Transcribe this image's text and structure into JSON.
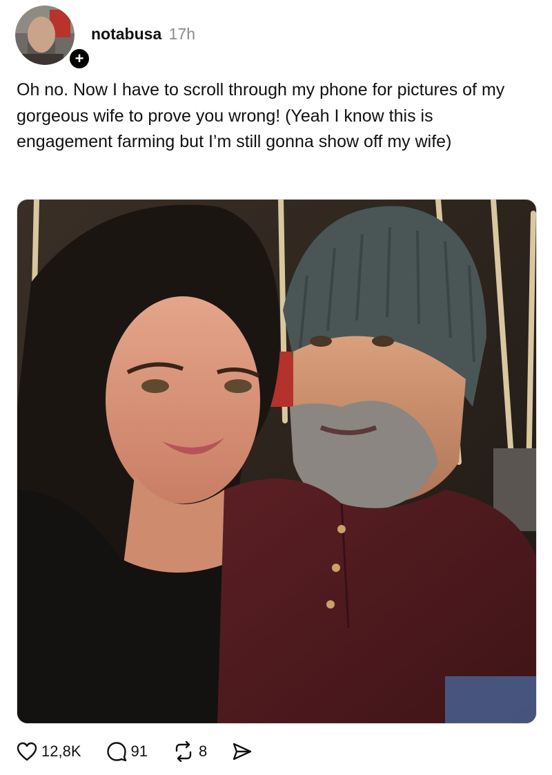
{
  "post": {
    "username": "notabusa",
    "time": "17h",
    "follow_symbol": "+",
    "text": "Oh no. Now I have to scroll through my phone for pictures of my gorgeous wife to prove you wrong! (Yeah I know this is engagement farming but I’m still gonna show off my wife)",
    "image_icon": "photo-couple-selfie"
  },
  "actions": {
    "likes": "12,8K",
    "replies": "91",
    "reposts": "8",
    "icons": [
      "heart-icon",
      "comment-icon",
      "repost-icon",
      "share-icon"
    ]
  },
  "colors": {
    "text": "#111111",
    "muted": "#8a8a8a",
    "background": "#ffffff"
  }
}
